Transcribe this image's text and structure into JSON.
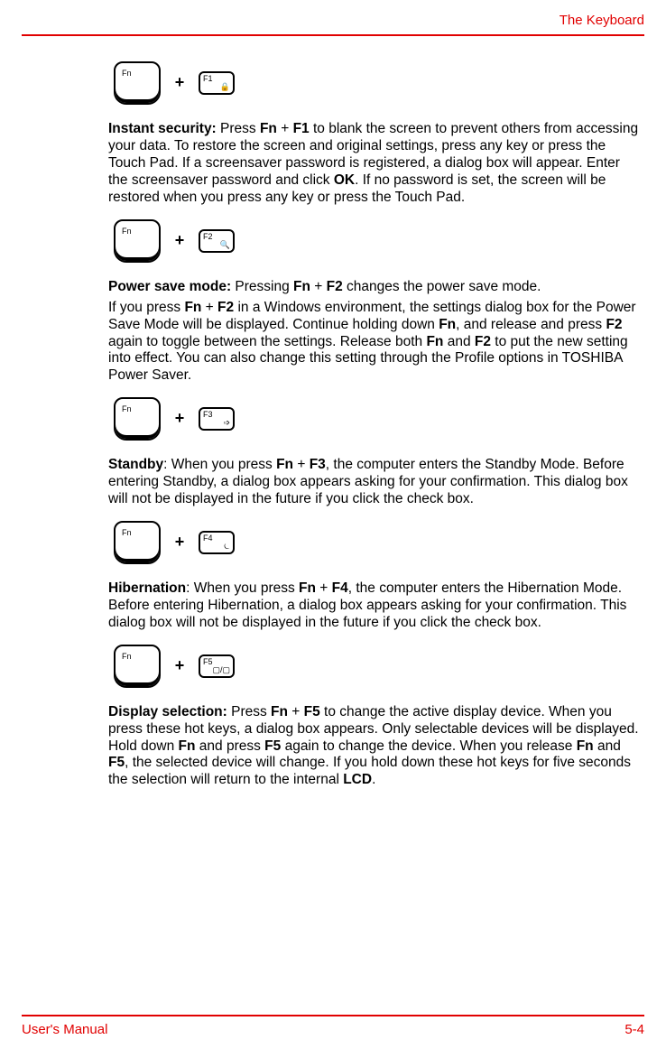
{
  "header": {
    "title": "The Keyboard"
  },
  "keys": {
    "fn": "Fn",
    "f1": "F1",
    "f2": "F2",
    "f3": "F3",
    "f4": "F4",
    "f5": "F5",
    "plus": "+"
  },
  "glyphs": {
    "f1": "🔒",
    "f2": "🔍",
    "f3": "➩",
    "f4": "⏾",
    "f5": "▢/▢"
  },
  "sections": {
    "s1": {
      "title": "Instant security:",
      "body_a": " Press ",
      "k1": "Fn",
      "body_b": " + ",
      "k2": "F1",
      "body_c": " to blank the screen to prevent others from accessing your data. To restore the screen and original settings, press any key or press the Touch Pad. If a screensaver password is registered, a dialog box will appear. Enter the screensaver password and click ",
      "k3": "OK",
      "body_d": ". If no password is set, the screen will be restored when you press any key or press the Touch Pad."
    },
    "s2": {
      "line1_title": "Power save mode:",
      "line1_a": " Pressing ",
      "line1_k1": "Fn",
      "line1_b": " + ",
      "line1_k2": "F2",
      "line1_c": " changes the power save mode.",
      "line2_a": "If you press ",
      "line2_k1": "Fn",
      "line2_b": " + ",
      "line2_k2": "F2",
      "line2_c": " in a Windows environment, the settings dialog box for the Power Save Mode will be displayed. Continue holding down ",
      "line2_k3": "Fn",
      "line2_d": ", and release and press ",
      "line2_k4": "F2",
      "line2_e": " again to toggle between the settings. Release both ",
      "line2_k5": "Fn",
      "line2_f": " and ",
      "line2_k6": "F2",
      "line2_g": " to put the new setting into effect. You can also change this setting through the Profile options in TOSHIBA Power Saver."
    },
    "s3": {
      "title": "Standby",
      "a": ": When you press ",
      "k1": "Fn",
      "b": " + ",
      "k2": "F3",
      "c": ", the computer enters the Standby Mode. Before entering Standby, a dialog box appears asking for your confirmation. This dialog box will not be displayed in the future if you click the check box."
    },
    "s4": {
      "title": "Hibernation",
      "a": ": When you press ",
      "k1": "Fn",
      "b": " + ",
      "k2": "F4",
      "c": ", the computer enters the Hibernation Mode. Before entering Hibernation, a dialog box appears asking for your confirmation. This dialog box will not be displayed in the future if you click the check box."
    },
    "s5": {
      "title": "Display selection:",
      "a": " Press ",
      "k1": "Fn",
      "b": " + ",
      "k2": "F5",
      "c": " to change the active display device. When you press these hot keys, a dialog box appears. Only selectable devices will be displayed. Hold down ",
      "k3": "Fn",
      "d": " and press ",
      "k4": "F5",
      "e": " again to change the device. When you release ",
      "k5": "Fn",
      "f": " and ",
      "k6": "F5",
      "g": ", the selected device will change. If you hold down these hot keys for five seconds the selection will return to the internal ",
      "k7": "LCD",
      "h": "."
    }
  },
  "footer": {
    "left": "User's Manual",
    "right": "5-4"
  }
}
